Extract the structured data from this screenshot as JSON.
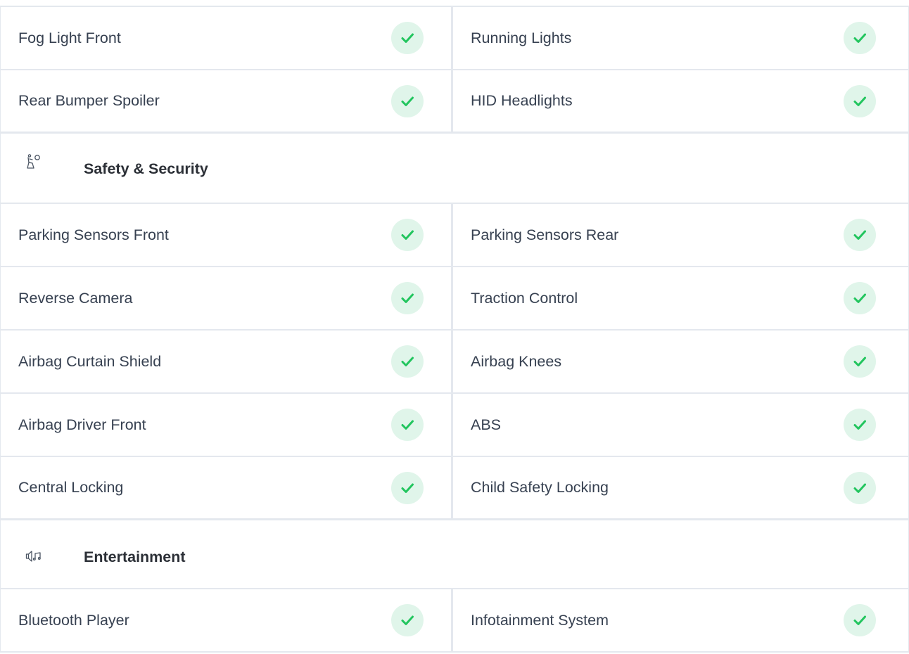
{
  "colors": {
    "check": "#22c55e",
    "check_bg": "#e0f5ea",
    "border": "#e4e8ee"
  },
  "rows_top": [
    {
      "left": "Fog Light Front",
      "right": "Running Lights"
    },
    {
      "left": "Rear Bumper Spoiler",
      "right": "HID Headlights"
    }
  ],
  "safety": {
    "icon": "airbag-seat-icon",
    "title": "Safety & Security",
    "rows": [
      {
        "left": "Parking Sensors Front",
        "right": "Parking Sensors Rear"
      },
      {
        "left": "Reverse Camera",
        "right": "Traction Control"
      },
      {
        "left": "Airbag Curtain Shield",
        "right": "Airbag Knees"
      },
      {
        "left": "Airbag Driver Front",
        "right": "ABS"
      },
      {
        "left": "Central Locking",
        "right": "Child Safety Locking"
      }
    ]
  },
  "entertainment": {
    "icon": "speaker-music-icon",
    "title": "Entertainment",
    "rows": [
      {
        "left": "Bluetooth Player",
        "right": "Infotainment System"
      }
    ]
  }
}
